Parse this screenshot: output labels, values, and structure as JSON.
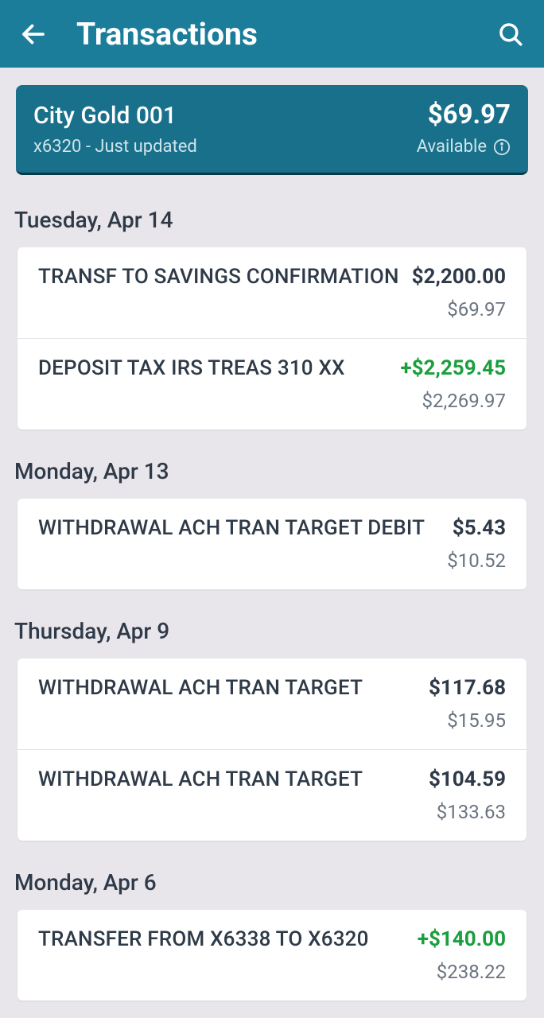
{
  "header": {
    "title": "Transactions"
  },
  "account": {
    "name": "City Gold 001",
    "balance": "$69.97",
    "sub": "x6320 - Just updated",
    "available_label": "Available"
  },
  "groups": [
    {
      "date": "Tuesday, Apr 14",
      "txns": [
        {
          "desc": "TRANSF TO SAVINGS CONFIRMATION",
          "amount": "$2,200.00",
          "credit": false,
          "balance": "$69.97"
        },
        {
          "desc": "DEPOSIT TAX IRS TREAS 310 XX",
          "amount": "+$2,259.45",
          "credit": true,
          "balance": "$2,269.97"
        }
      ]
    },
    {
      "date": "Monday, Apr 13",
      "txns": [
        {
          "desc": "WITHDRAWAL ACH TRAN TARGET DEBIT",
          "amount": "$5.43",
          "credit": false,
          "balance": "$10.52"
        }
      ]
    },
    {
      "date": "Thursday, Apr 9",
      "txns": [
        {
          "desc": "WITHDRAWAL ACH TRAN TARGET",
          "amount": "$117.68",
          "credit": false,
          "balance": "$15.95"
        },
        {
          "desc": "WITHDRAWAL ACH TRAN TARGET",
          "amount": "$104.59",
          "credit": false,
          "balance": "$133.63"
        }
      ]
    },
    {
      "date": "Monday, Apr 6",
      "txns": [
        {
          "desc": "TRANSFER FROM X6338 TO X6320",
          "amount": "+$140.00",
          "credit": true,
          "balance": "$238.22"
        }
      ]
    }
  ]
}
